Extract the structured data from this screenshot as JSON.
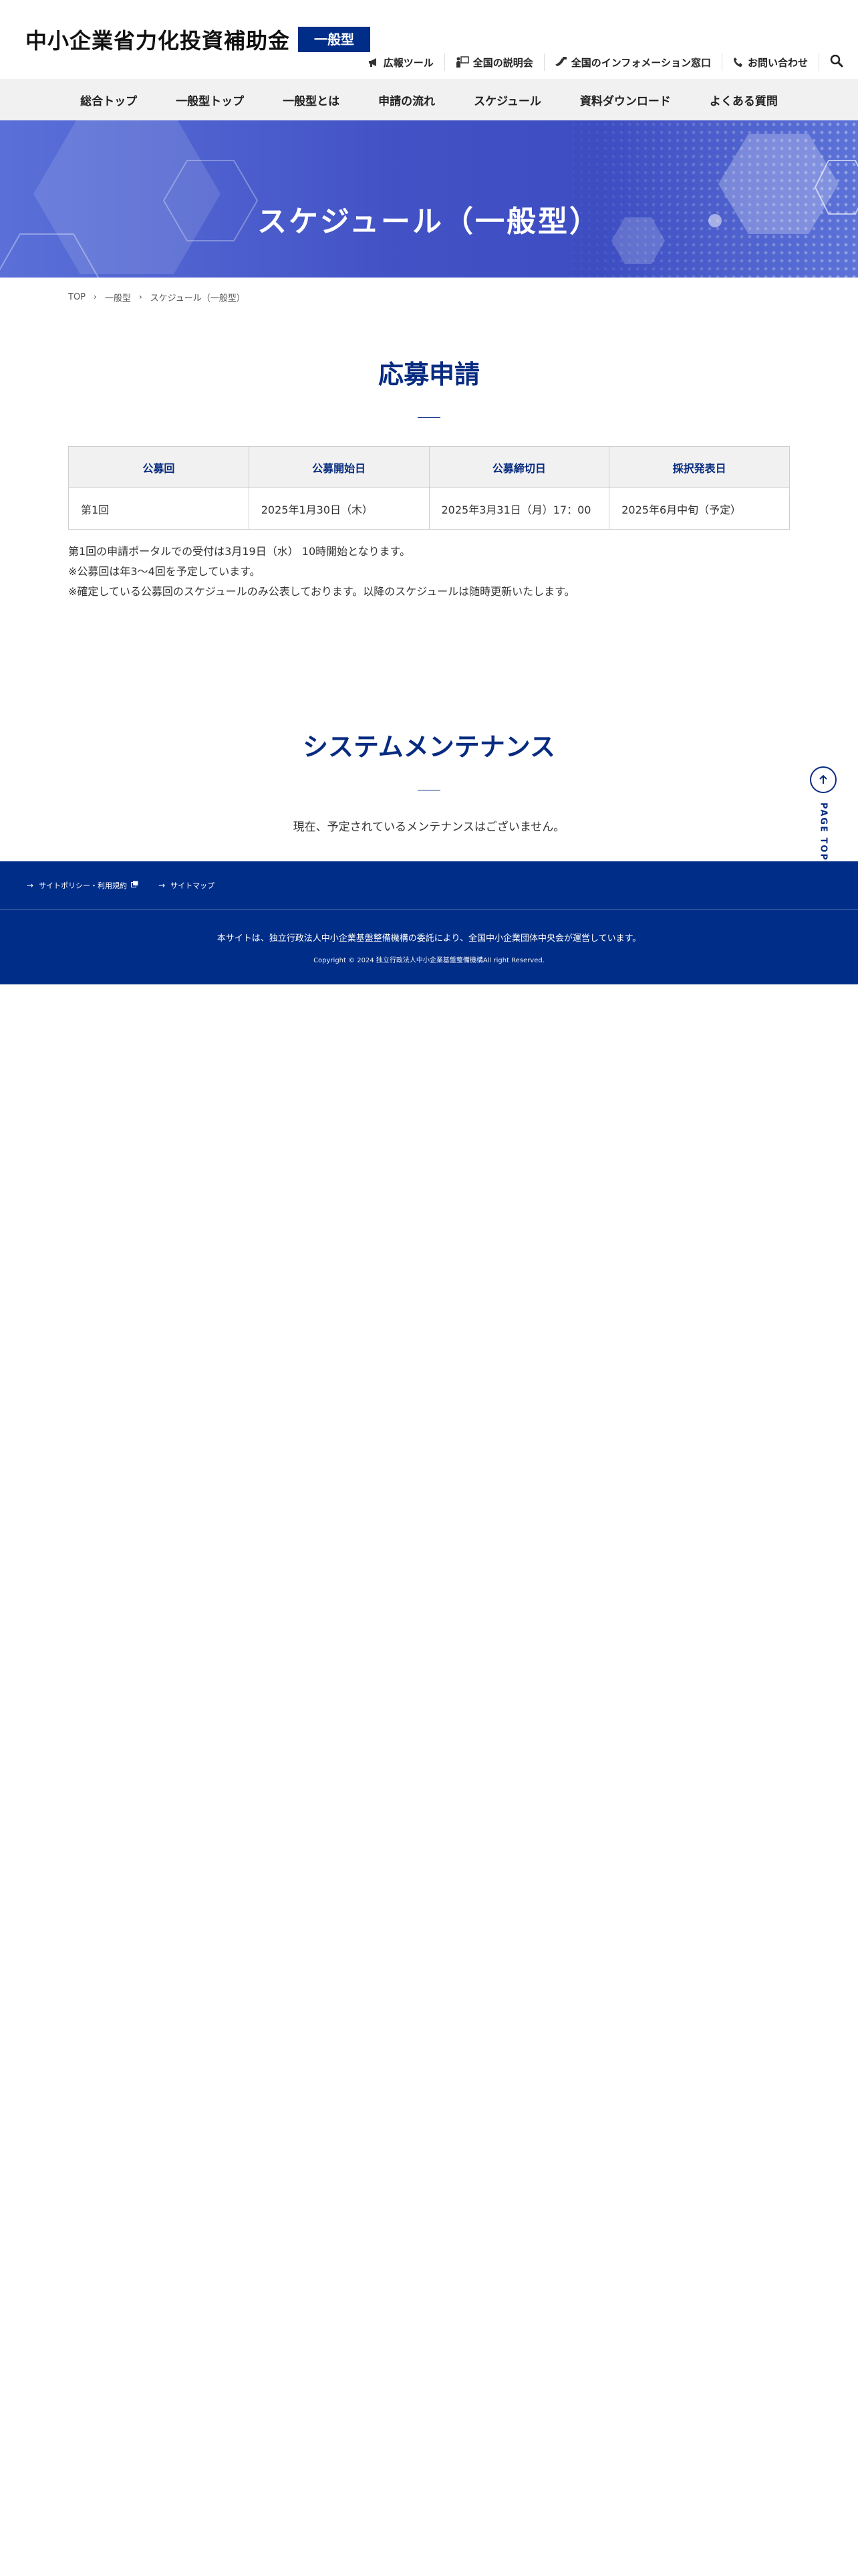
{
  "header": {
    "site_title": "中小企業省力化投資補助金",
    "site_badge": "一般型",
    "util_links": [
      {
        "label": "広報ツール",
        "icon": "megaphone-icon"
      },
      {
        "label": "全国の説明会",
        "icon": "presentation-icon"
      },
      {
        "label": "全国のインフォメーション窓口",
        "icon": "phone-handset-icon"
      },
      {
        "label": "お問い合わせ",
        "icon": "phone-icon"
      }
    ],
    "search_icon": "search-icon"
  },
  "nav": {
    "items": [
      "総合トップ",
      "一般型トップ",
      "一般型とは",
      "申請の流れ",
      "スケジュール",
      "資料ダウンロード",
      "よくある質問"
    ]
  },
  "hero": {
    "title": "スケジュール（一般型）"
  },
  "breadcrumb": {
    "items": [
      "TOP",
      "一般型",
      "スケジュール（一般型）"
    ]
  },
  "apply": {
    "title": "応募申請",
    "columns": [
      "公募回",
      "公募開始日",
      "公募締切日",
      "採択発表日"
    ],
    "rows": [
      [
        "第1回",
        "2025年1月30日（木）",
        "2025年3月31日（月）17：00",
        "2025年6月中旬（予定）"
      ]
    ],
    "notes": [
      "第1回の申請ポータルでの受付は3月19日（水） 10時開始となります。",
      "※公募回は年3～4回を予定しています。",
      "※確定している公募回のスケジュールのみ公表しております。以降のスケジュールは随時更新いたします。"
    ]
  },
  "maintenance": {
    "title": "システムメンテナンス",
    "text": "現在、予定されているメンテナンスはございません。"
  },
  "page_top": {
    "label": "PAGE TOP"
  },
  "footer": {
    "links": [
      "サイトポリシー・利用規約",
      "サイトマップ"
    ],
    "note": "本サイトは、独立行政法人中小企業基盤整備機構の委託により、全国中小企業団体中央会が運営しています。",
    "copyright": "Copyright © 2024 独立行政法人中小企業基盤整備機構All right Reserved."
  },
  "colors": {
    "brand_navy": "#002d87",
    "heading_navy": "#072b80",
    "nav_bg": "#f1f1f1",
    "hero_blue": "#4353c6"
  }
}
